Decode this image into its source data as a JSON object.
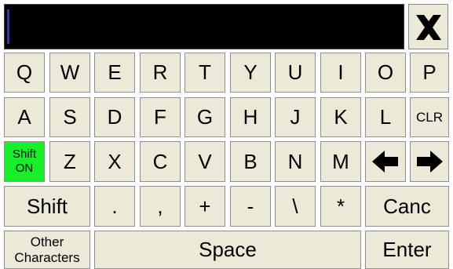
{
  "display": {
    "value": ""
  },
  "rows": [
    [
      "Q",
      "W",
      "E",
      "R",
      "T",
      "Y",
      "U",
      "I",
      "O",
      "P"
    ],
    [
      "A",
      "S",
      "D",
      "F",
      "G",
      "H",
      "J",
      "K",
      "L",
      "CLR"
    ],
    [
      "Z",
      "X",
      "C",
      "V",
      "B",
      "N",
      "M"
    ],
    [
      ".",
      ",",
      "+",
      "-",
      "\\",
      "*"
    ]
  ],
  "shift_toggle": {
    "line1": "Shift",
    "line2": "ON",
    "color": "#16f027"
  },
  "shift_label": "Shift",
  "cancel_label": "Canc",
  "other_chars": {
    "line1": "Other",
    "line2": "Characters"
  },
  "space_label": "Space",
  "enter_label": "Enter",
  "icons": {
    "close": "close-x-icon",
    "left": "arrow-left-icon",
    "right": "arrow-right-icon"
  },
  "colors": {
    "key": "#ece9d8",
    "display": "#000000",
    "shift_on": "#16f027"
  }
}
